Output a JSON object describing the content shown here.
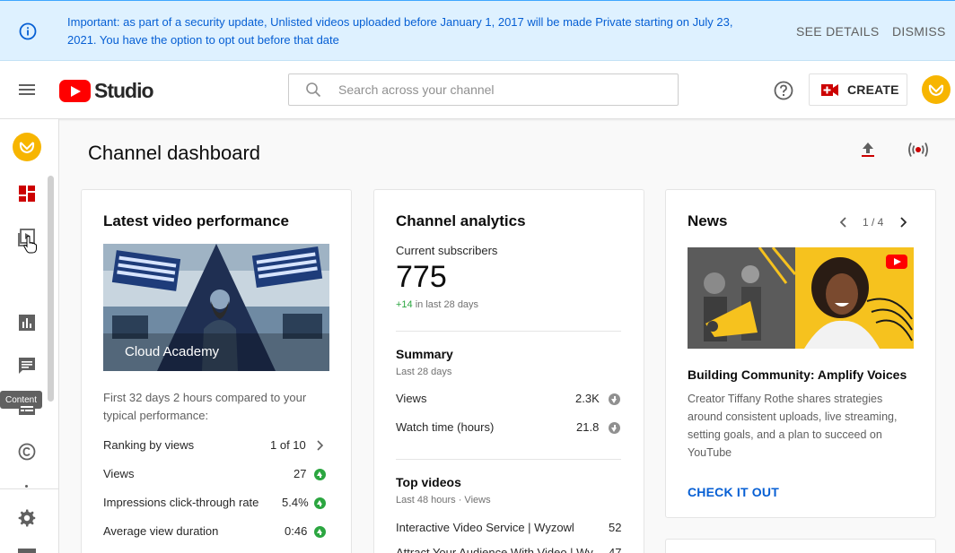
{
  "banner": {
    "message": "Important: as part of a security update, Unlisted videos uploaded before January 1, 2017 will be made Private starting on July 23, 2021. You have the option to opt out before that date",
    "see_details": "SEE DETAILS",
    "dismiss": "DISMISS"
  },
  "header": {
    "logo_text": "Studio",
    "search_placeholder": "Search across your channel",
    "create_label": "CREATE"
  },
  "sidebar": {
    "tooltip": "Content"
  },
  "main": {
    "title": "Channel dashboard"
  },
  "latest": {
    "title": "Latest video performance",
    "thumb_caption": "Cloud Academy",
    "compare_text": "First 32 days 2 hours compared to your typical performance:",
    "ranking_label": "Ranking by views",
    "ranking_value": "1 of 10",
    "metrics": [
      {
        "label": "Views",
        "value": "27"
      },
      {
        "label": "Impressions click-through rate",
        "value": "5.4%"
      },
      {
        "label": "Average view duration",
        "value": "0:46"
      }
    ]
  },
  "analytics": {
    "title": "Channel analytics",
    "subs_label": "Current subscribers",
    "subs_value": "775",
    "subs_change": "+14",
    "subs_change_period": "in last 28 days",
    "summary_title": "Summary",
    "summary_period": "Last 28 days",
    "summary_rows": [
      {
        "label": "Views",
        "value": "2.3K"
      },
      {
        "label": "Watch time (hours)",
        "value": "21.8"
      }
    ],
    "top_title": "Top videos",
    "top_period": "Last 48 hours · Views",
    "top_rows": [
      {
        "label": "Interactive Video Service | Wyzowl",
        "value": "52"
      },
      {
        "label": "Attract Your Audience With Video | Wy…",
        "value": "47"
      }
    ]
  },
  "news": {
    "title": "News",
    "pager": "1 / 4",
    "headline": "Building Community: Amplify Voices",
    "body": "Creator Tiffany Rothe shares strategies around consistent uploads, live streaming, setting goals, and a plan to succeed on YouTube",
    "cta": "CHECK IT OUT"
  },
  "colors": {
    "brand_red": "#ff0000",
    "link_blue": "#065fd4",
    "banner_bg": "#def1ff",
    "positive_green": "#2ba640",
    "avatar_yellow": "#f7b500"
  }
}
